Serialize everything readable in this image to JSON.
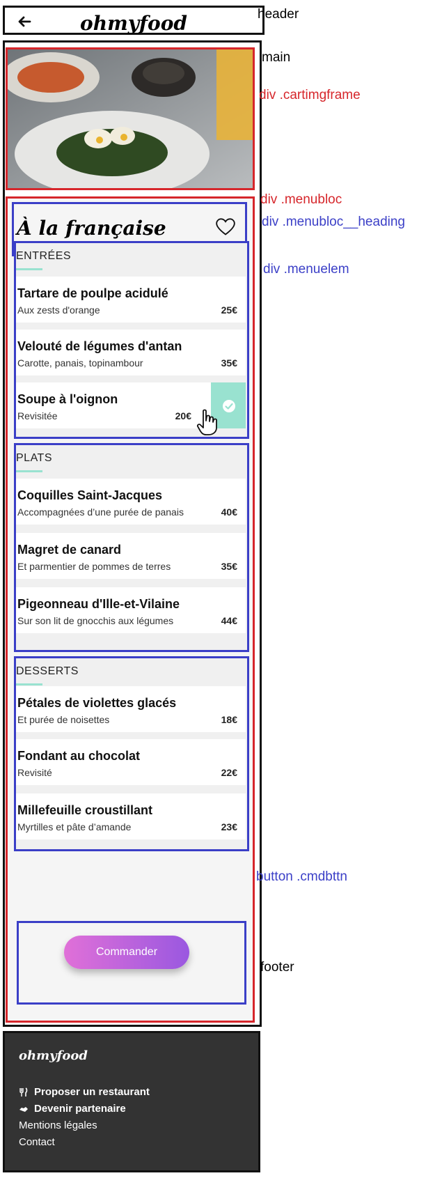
{
  "header": {
    "logo": "ohmyfood"
  },
  "restaurant": {
    "title": "À la française"
  },
  "sections": [
    {
      "title": "ENTRÉES",
      "items": [
        {
          "name": "Tartare de poulpe acidulé",
          "desc": "Aux zests d'orange",
          "price": "25€"
        },
        {
          "name": "Velouté de légumes d'antan",
          "desc": "Carotte, panais, topinambour",
          "price": "35€"
        },
        {
          "name": "Soupe à l'oignon",
          "desc": "Revisitée",
          "price": "20€",
          "selected": true
        }
      ]
    },
    {
      "title": "PLATS",
      "items": [
        {
          "name": "Coquilles Saint-Jacques",
          "desc": "Accompagnées d’une purée de panais",
          "price": "40€"
        },
        {
          "name": "Magret de canard",
          "desc": "Et parmentier de pommes de terres",
          "price": "35€"
        },
        {
          "name": "Pigeonneau d'Ille-et-Vilaine",
          "desc": "Sur son lit de gnocchis aux légumes",
          "price": "44€"
        }
      ]
    },
    {
      "title": "DESSERTS",
      "items": [
        {
          "name": "Pétales de violettes glacés",
          "desc": "Et purée de noisettes",
          "price": "18€"
        },
        {
          "name": "Fondant au chocolat",
          "desc": "Revisité",
          "price": "22€"
        },
        {
          "name": "Millefeuille croustillant",
          "desc": "Myrtilles et pâte d’amande",
          "price": "23€"
        }
      ]
    }
  ],
  "button": {
    "label": "Commander"
  },
  "footer": {
    "logo": "ohmyfood",
    "links": [
      "Proposer un restaurant",
      "Devenir partenaire",
      "Mentions légales",
      "Contact"
    ]
  },
  "annotations": {
    "header": "header",
    "main": "main",
    "cartimgframe": "div .cartimgframe",
    "menubloc": "div .menubloc",
    "menubloc_heading": "div .menubloc__heading",
    "menuelem": "div .menuelem",
    "cmdbttn": "button .cmdbttn",
    "footer": "footer"
  },
  "colors": {
    "accent": "#99e2d0",
    "annotation_red": "#d6262b",
    "annotation_blue": "#3b3fc7",
    "button_from": "#e070d8",
    "button_to": "#9a58e0"
  },
  "icons": {
    "back": "arrow-left-icon",
    "favorite": "heart-icon",
    "selected": "check-circle-icon",
    "cursor": "hand-pointer-icon",
    "utensils": "utensils-icon",
    "handshake": "handshake-icon"
  }
}
